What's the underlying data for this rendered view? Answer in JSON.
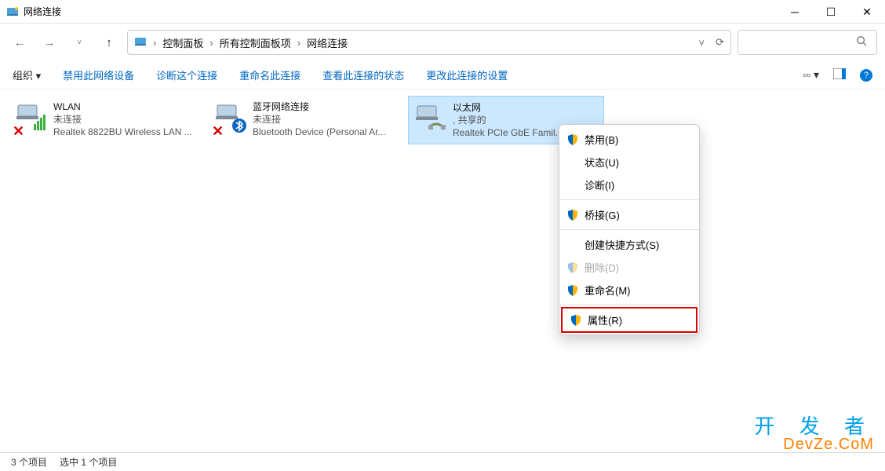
{
  "window": {
    "title": "网络连接"
  },
  "breadcrumbs": {
    "root": "控制面板",
    "mid": "所有控制面板项",
    "leaf": "网络连接"
  },
  "commands": {
    "organize": "组织 ▾",
    "disable": "禁用此网络设备",
    "diagnose": "诊断这个连接",
    "rename": "重命名此连接",
    "status": "查看此连接的状态",
    "settings": "更改此连接的设置"
  },
  "connections": [
    {
      "name": "WLAN",
      "status": "未连接",
      "device": "Realtek 8822BU Wireless LAN ...",
      "error": true,
      "adapterType": "wifi"
    },
    {
      "name": "蓝牙网络连接",
      "status": "未连接",
      "device": "Bluetooth Device (Personal Ar...",
      "error": true,
      "adapterType": "bluetooth"
    },
    {
      "name": "以太网",
      "status": ", 共享的",
      "device": "Realtek PCIe GbE Famil...",
      "error": false,
      "adapterType": "ethernet",
      "selected": true
    }
  ],
  "contextMenu": {
    "disable": "禁用(B)",
    "status": "状态(U)",
    "diagnose": "诊断(I)",
    "bridge": "桥接(G)",
    "shortcut": "创建快捷方式(S)",
    "delete": "删除(D)",
    "rename": "重命名(M)",
    "properties": "属性(R)"
  },
  "statusbar": {
    "count": "3 个项目",
    "selected": "选中 1 个项目"
  },
  "watermark": {
    "cn": "开 发 者",
    "en": "DevZe.CoM"
  }
}
